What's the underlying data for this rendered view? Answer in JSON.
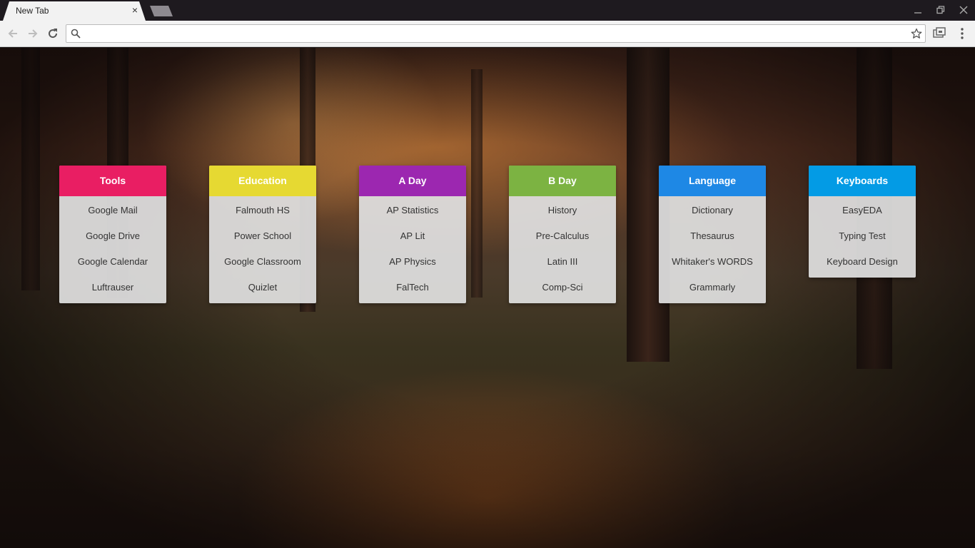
{
  "browser": {
    "tab_title": "New Tab",
    "tab_close": "×",
    "omnibox_value": "",
    "omnibox_placeholder": ""
  },
  "colors": {
    "tools": "#e91e63",
    "education": "#e6d932",
    "a_day": "#9c27b0",
    "b_day": "#7cb342",
    "language": "#1e88e5",
    "keyboards": "#039be5"
  },
  "cards": [
    {
      "title": "Tools",
      "links": [
        "Google Mail",
        "Google Drive",
        "Google Calendar",
        "Luftrauser"
      ]
    },
    {
      "title": "Education",
      "links": [
        "Falmouth HS",
        "Power School",
        "Google Classroom",
        "Quizlet"
      ]
    },
    {
      "title": "A Day",
      "links": [
        "AP Statistics",
        "AP Lit",
        "AP Physics",
        "FalTech"
      ]
    },
    {
      "title": "B Day",
      "links": [
        "History",
        "Pre-Calculus",
        "Latin III",
        "Comp-Sci"
      ]
    },
    {
      "title": "Language",
      "links": [
        "Dictionary",
        "Thesaurus",
        "Whitaker's WORDS",
        "Grammarly"
      ]
    },
    {
      "title": "Keyboards",
      "links": [
        "EasyEDA",
        "Typing Test",
        "Keyboard Design"
      ]
    }
  ]
}
